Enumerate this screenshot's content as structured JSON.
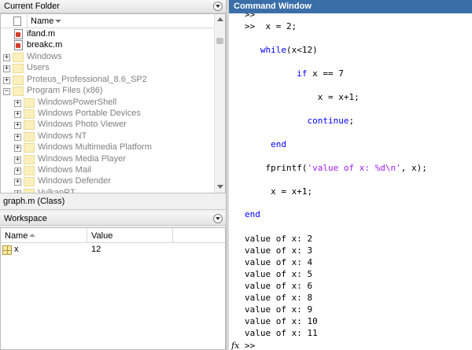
{
  "current_folder": {
    "title": "Current Folder",
    "column_name": "Name",
    "items": [
      {
        "label": "ifand.m",
        "type": "mfile"
      },
      {
        "label": "breakc.m",
        "type": "mfile"
      },
      {
        "label": "Windows",
        "type": "folder",
        "expander": "+",
        "gray": true
      },
      {
        "label": "Users",
        "type": "folder",
        "expander": "+",
        "gray": true
      },
      {
        "label": "Proteus_Professional_8.6_SP2",
        "type": "folder",
        "expander": "+",
        "gray": true
      },
      {
        "label": "Program Files (x86)",
        "type": "folder",
        "expander": "−",
        "gray": true
      },
      {
        "label": "WindowsPowerShell",
        "type": "folder",
        "expander": "+",
        "gray": true
      },
      {
        "label": "Windows Portable Devices",
        "type": "folder",
        "expander": "+",
        "gray": true
      },
      {
        "label": "Windows Photo Viewer",
        "type": "folder",
        "expander": "+",
        "gray": true
      },
      {
        "label": "Windows NT",
        "type": "folder",
        "expander": "+",
        "gray": true
      },
      {
        "label": "Windows Multimedia Platform",
        "type": "folder",
        "expander": "+",
        "gray": true
      },
      {
        "label": "Windows Media Player",
        "type": "folder",
        "expander": "+",
        "gray": true
      },
      {
        "label": "Windows Mail",
        "type": "folder",
        "expander": "+",
        "gray": true
      },
      {
        "label": "Windows Defender",
        "type": "folder",
        "expander": "+",
        "gray": true
      },
      {
        "label": "VulkanRT",
        "type": "folder",
        "expander": "+",
        "gray": true
      }
    ]
  },
  "details": {
    "label": "graph.m  (Class)"
  },
  "workspace": {
    "title": "Workspace",
    "columns": {
      "name": "Name",
      "value": "Value"
    },
    "variables": [
      {
        "name": "x",
        "value": "12"
      }
    ]
  },
  "command_window": {
    "title": "Command Window",
    "fx_label": "fx",
    "prompt": ">>",
    "lines": [
      {
        "segments": [
          {
            "t": ">>"
          }
        ]
      },
      {
        "segments": [
          {
            "t": ">>  x = 2;"
          }
        ]
      },
      {
        "segments": [
          {
            "t": "   "
          },
          {
            "t": "while",
            "c": "kw"
          },
          {
            "t": "(x<12)"
          }
        ]
      },
      {
        "segments": [
          {
            "t": "          "
          },
          {
            "t": "if",
            "c": "kw"
          },
          {
            "t": " x == 7"
          }
        ]
      },
      {
        "segments": [
          {
            "t": "              x = x+1;"
          }
        ]
      },
      {
        "segments": [
          {
            "t": "            "
          },
          {
            "t": "continue",
            "c": "kw"
          },
          {
            "t": ";"
          }
        ]
      },
      {
        "segments": [
          {
            "t": "     "
          },
          {
            "t": "end",
            "c": "kw"
          }
        ]
      },
      {
        "segments": [
          {
            "t": "    fprintf("
          },
          {
            "t": "'value of x: %d\\n'",
            "c": "str"
          },
          {
            "t": ", x);"
          }
        ]
      },
      {
        "segments": [
          {
            "t": "     x = x+1;"
          }
        ]
      },
      {
        "segments": [
          {
            "t": "end",
            "c": "kw"
          }
        ]
      },
      {
        "segments": [
          {
            "t": "value of x: 2"
          }
        ]
      },
      {
        "segments": [
          {
            "t": "value of x: 3"
          }
        ]
      },
      {
        "segments": [
          {
            "t": "value of x: 4"
          }
        ]
      },
      {
        "segments": [
          {
            "t": "value of x: 5"
          }
        ]
      },
      {
        "segments": [
          {
            "t": "value of x: 6"
          }
        ]
      },
      {
        "segments": [
          {
            "t": "value of x: 8"
          }
        ]
      },
      {
        "segments": [
          {
            "t": "value of x: 9"
          }
        ]
      },
      {
        "segments": [
          {
            "t": "value of x: 10"
          }
        ]
      },
      {
        "segments": [
          {
            "t": "value of x: 11"
          }
        ]
      }
    ]
  }
}
